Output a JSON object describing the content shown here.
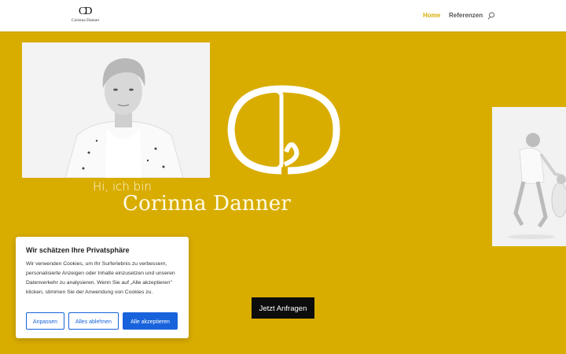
{
  "header": {
    "logo_mark": "CD",
    "logo_text": "Corinna Danner",
    "nav": [
      {
        "label": "Home",
        "active": true
      },
      {
        "label": "Referenzen",
        "active": false
      }
    ]
  },
  "hero": {
    "greeting": "Hi, ich bin",
    "name": "Corinna Danner",
    "cta_label": "Jetzt Anfragen"
  },
  "cookie_banner": {
    "title": "Wir schätzen Ihre Privatsphäre",
    "text": "Wir verwenden Cookies, um Ihr Surferlebnis zu verbessern, personalisierte Anzeigen oder Inhalte einzusetzen und unseren Datenverkehr zu analysieren. Wenn Sie auf „Alle akzeptieren\" klicken, stimmen Sie der Anwendung von Cookies zu.",
    "buttons": {
      "customize": "Anpassen",
      "reject": "Alles ablehnen",
      "accept": "Alle akzeptieren"
    }
  },
  "colors": {
    "brand_yellow": "#d9ad00",
    "button_blue": "#1863dc",
    "cta_black": "#0d0d0d"
  }
}
